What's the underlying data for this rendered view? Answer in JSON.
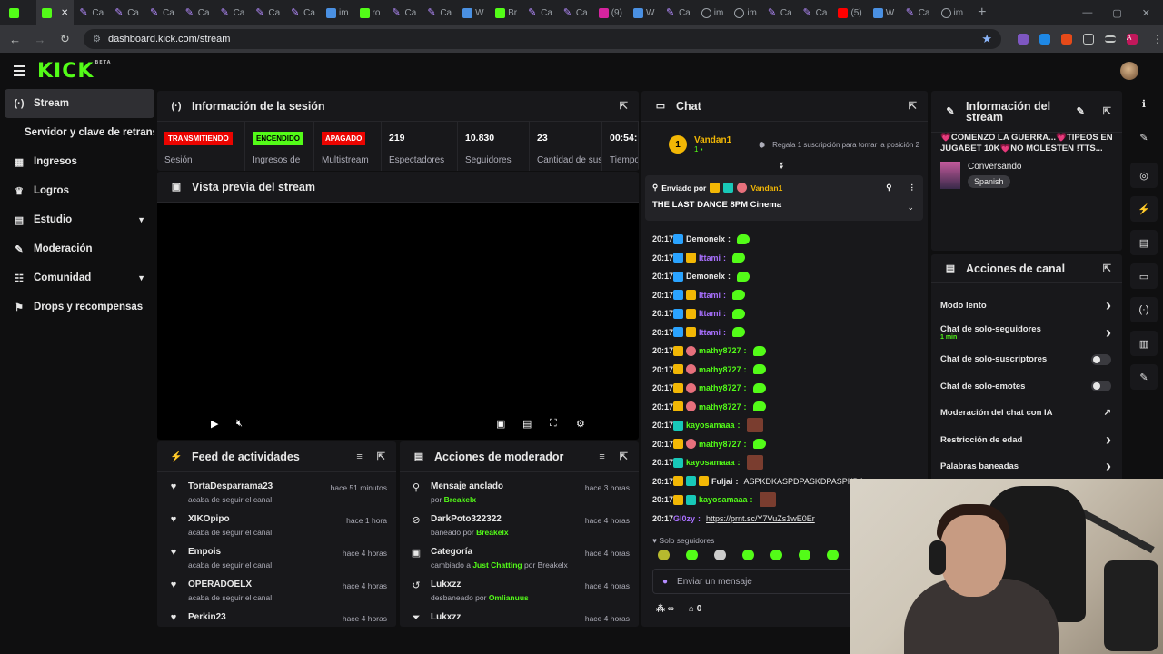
{
  "browser": {
    "tabs": [
      {
        "icon": "kick-logo-icon",
        "label": "",
        "active": false
      },
      {
        "icon": "kick-logo-icon",
        "label": "",
        "active": true
      },
      {
        "icon": "claude-icon",
        "label": "Ca"
      },
      {
        "icon": "claude-icon",
        "label": "Ca"
      },
      {
        "icon": "claude-icon",
        "label": "Ca"
      },
      {
        "icon": "claude-icon",
        "label": "Ca"
      },
      {
        "icon": "claude-icon",
        "label": "Ca"
      },
      {
        "icon": "claude-icon",
        "label": "Ca"
      },
      {
        "icon": "claude-icon",
        "label": "Ca"
      },
      {
        "icon": "blue-site-icon",
        "label": "im"
      },
      {
        "icon": "kick-logo-icon",
        "label": "ro"
      },
      {
        "icon": "claude-icon",
        "label": "Ca"
      },
      {
        "icon": "claude-icon",
        "label": "Ca"
      },
      {
        "icon": "blue-site-icon",
        "label": "W"
      },
      {
        "icon": "kick-logo-icon",
        "label": "Br"
      },
      {
        "icon": "claude-icon",
        "label": "Ca"
      },
      {
        "icon": "claude-icon",
        "label": "Ca"
      },
      {
        "icon": "instagram-icon",
        "label": "(9)"
      },
      {
        "icon": "blue-site-icon",
        "label": "W"
      },
      {
        "icon": "claude-icon",
        "label": "Ca"
      },
      {
        "icon": "globe-icon",
        "label": "im"
      },
      {
        "icon": "globe-icon",
        "label": "im"
      },
      {
        "icon": "claude-icon",
        "label": "Ca"
      },
      {
        "icon": "claude-icon",
        "label": "Ca"
      },
      {
        "icon": "youtube-icon",
        "label": "(5)"
      },
      {
        "icon": "blue-site-icon",
        "label": "W"
      },
      {
        "icon": "claude-icon",
        "label": "Ca"
      },
      {
        "icon": "globe-icon",
        "label": "im"
      }
    ],
    "url": "dashboard.kick.com/stream",
    "profile_initial": "A"
  },
  "site": {
    "logo": "KICK",
    "beta": "BETA"
  },
  "leftnav": [
    {
      "icon": "stream-icon",
      "glyph": "(·)",
      "label": "Stream",
      "selected": true,
      "sub": false,
      "chev": false
    },
    {
      "icon": "",
      "glyph": "",
      "label": "Servidor y clave de retransmisión",
      "selected": false,
      "sub": true,
      "chev": false
    },
    {
      "icon": "revenue-icon",
      "glyph": "▦",
      "label": "Ingresos",
      "selected": false,
      "sub": false,
      "chev": false
    },
    {
      "icon": "trophy-icon",
      "glyph": "♛",
      "label": "Logros",
      "selected": false,
      "sub": false,
      "chev": false
    },
    {
      "icon": "studio-icon",
      "glyph": "▤",
      "label": "Estudio",
      "selected": false,
      "sub": false,
      "chev": true
    },
    {
      "icon": "wrench-icon",
      "glyph": "✎",
      "label": "Moderación",
      "selected": false,
      "sub": false,
      "chev": false
    },
    {
      "icon": "community-icon",
      "glyph": "☷",
      "label": "Comunidad",
      "selected": false,
      "sub": false,
      "chev": true
    },
    {
      "icon": "gift-icon",
      "glyph": "⚑",
      "label": "Drops y recompensas",
      "selected": false,
      "sub": false,
      "chev": false
    }
  ],
  "session": {
    "title": "Información de la sesión",
    "metrics": [
      {
        "value": "TRANSMITIENDO",
        "type": "red",
        "label": "Sesión",
        "w": 97
      },
      {
        "value": "ENCENDIDO",
        "type": "green",
        "label": "Ingresos de",
        "w": 76
      },
      {
        "value": "APAGADO",
        "type": "red",
        "label": "Multistream",
        "w": 74
      },
      {
        "value": "219",
        "type": "num",
        "label": "Espectadores",
        "w": 84
      },
      {
        "value": "10.830",
        "type": "num",
        "label": "Seguidores",
        "w": 79
      },
      {
        "value": "23",
        "type": "num",
        "label": "Cantidad de suscripciones",
        "w": 80
      },
      {
        "value": "00:54:",
        "type": "num",
        "label": "Tiempo en vivo",
        "w": 40
      }
    ]
  },
  "preview": {
    "title": "Vista previa del stream"
  },
  "feed": {
    "title": "Feed de actividades",
    "items": [
      {
        "name": "TortaDesparrama23",
        "sub": "acaba de seguir el canal",
        "time": "hace 51 minutos"
      },
      {
        "name": "XIKOpipo",
        "sub": "acaba de seguir el canal",
        "time": "hace 1 hora"
      },
      {
        "name": "Empois",
        "sub": "acaba de seguir el canal",
        "time": "hace 4 horas"
      },
      {
        "name": "OPERADOELX",
        "sub": "acaba de seguir el canal",
        "time": "hace 4 horas"
      },
      {
        "name": "Perkin23",
        "sub": "",
        "time": "hace 4 horas"
      }
    ]
  },
  "modactions": {
    "title": "Acciones de moderador",
    "items": [
      {
        "icon": "pin-icon",
        "glyph": "⚲",
        "name": "Mensaje anclado",
        "pre": "por ",
        "hl": "Breakelx",
        "post": "",
        "time": "hace 3 horas"
      },
      {
        "icon": "ban-icon",
        "glyph": "⊘",
        "name": "DarkPoto322322",
        "pre": "baneado por ",
        "hl": "Breakelx",
        "post": "",
        "time": "hace 4 horas"
      },
      {
        "icon": "category-icon",
        "glyph": "▣",
        "name": "Categoría",
        "pre": "cambiado a ",
        "hl": "Just Chatting",
        "post": " por Breakelx",
        "time": "hace 4 horas"
      },
      {
        "icon": "unban-icon",
        "glyph": "↺",
        "name": "Lukxzz",
        "pre": "desbaneado por ",
        "hl": "Omlianuus",
        "post": "",
        "time": "hace 4 horas"
      },
      {
        "icon": "filter-icon",
        "glyph": "⏷",
        "name": "Lukxzz",
        "pre": "",
        "hl": "",
        "post": "",
        "time": "hace 4 horas"
      }
    ]
  },
  "chat": {
    "title": "Chat",
    "goal_user": "Vandan1",
    "goal_rank": "1",
    "goal_count": "1",
    "goal_text": "Regala 1 suscripción para tomar la posición 2",
    "pinned_by_label": "Enviado por",
    "pinned_user": "Vandan1",
    "pinned_msg": "THE LAST DANCE 8PM Cinema",
    "messages": [
      {
        "time": "20:17",
        "user": "Demonelx",
        "color": "#e7e7e7",
        "badges": [
          "blue"
        ],
        "text": "",
        "emote": "green"
      },
      {
        "time": "20:17",
        "user": "Ittami",
        "color": "#a970ff",
        "badges": [
          "blue",
          "gold"
        ],
        "text": "",
        "emote": "green"
      },
      {
        "time": "20:17",
        "user": "Demonelx",
        "color": "#e7e7e7",
        "badges": [
          "blue"
        ],
        "text": "",
        "emote": "green"
      },
      {
        "time": "20:17",
        "user": "Ittami",
        "color": "#a970ff",
        "badges": [
          "blue",
          "gold"
        ],
        "text": "",
        "emote": "green"
      },
      {
        "time": "20:17",
        "user": "Ittami",
        "color": "#a970ff",
        "badges": [
          "blue",
          "gold"
        ],
        "text": "",
        "emote": "green"
      },
      {
        "time": "20:17",
        "user": "Ittami",
        "color": "#a970ff",
        "badges": [
          "blue",
          "gold"
        ],
        "text": "",
        "emote": "green"
      },
      {
        "time": "20:17",
        "user": "mathy8727",
        "color": "#53fc18",
        "badges": [
          "gold",
          "pink"
        ],
        "text": "",
        "emote": "green"
      },
      {
        "time": "20:17",
        "user": "mathy8727",
        "color": "#53fc18",
        "badges": [
          "gold",
          "pink"
        ],
        "text": "",
        "emote": "green"
      },
      {
        "time": "20:17",
        "user": "mathy8727",
        "color": "#53fc18",
        "badges": [
          "gold",
          "pink"
        ],
        "text": "",
        "emote": "green"
      },
      {
        "time": "20:17",
        "user": "mathy8727",
        "color": "#53fc18",
        "badges": [
          "gold",
          "pink"
        ],
        "text": "",
        "emote": "green"
      },
      {
        "time": "20:17",
        "user": "kayosamaaa",
        "color": "#53fc18",
        "badges": [
          "teal"
        ],
        "text": "",
        "emote": "img"
      },
      {
        "time": "20:17",
        "user": "mathy8727",
        "color": "#53fc18",
        "badges": [
          "gold",
          "pink"
        ],
        "text": "",
        "emote": "green"
      },
      {
        "time": "20:17",
        "user": "kayosamaaa",
        "color": "#53fc18",
        "badges": [
          "teal"
        ],
        "text": "",
        "emote": "img"
      },
      {
        "time": "20:17",
        "user": "Fuljai",
        "color": "#e7e7e7",
        "badges": [
          "gold",
          "teal",
          "gold"
        ],
        "text": "ASPKDKASPDPASKDPASPKDA",
        "emote": ""
      },
      {
        "time": "20:17",
        "user": "kayosamaaa",
        "color": "#53fc18",
        "badges": [
          "gold",
          "teal"
        ],
        "text": "",
        "emote": "img"
      },
      {
        "time": "20:17",
        "user": "Gl0zy",
        "color": "#a970ff",
        "badges": [],
        "text": "https://prnt.sc/Y7VuZs1wE0Er",
        "emote": "",
        "link": true
      }
    ],
    "followers_only": "Solo seguidores",
    "input_placeholder": "Enviar un mensaje",
    "foot_count": "0"
  },
  "streaminfo": {
    "title": "Información del stream",
    "stream_title": "💗COMENZO LA GUERRA...💗TIPEOS EN JUGABET 10K💗NO MOLESTEN !TTS...",
    "category": "Conversando",
    "language": "Spanish"
  },
  "channelactions": {
    "title": "Acciones de canal",
    "rows": [
      {
        "label": "Modo lento",
        "sub": "",
        "ctl": "chevron"
      },
      {
        "label": "Chat de solo-seguidores",
        "sub": "1 min",
        "ctl": "chevron"
      },
      {
        "label": "Chat de solo-suscriptores",
        "sub": "",
        "ctl": "toggle"
      },
      {
        "label": "Chat de solo-emotes",
        "sub": "",
        "ctl": "toggle"
      },
      {
        "label": "Moderación del chat con IA",
        "sub": "",
        "ctl": "external"
      },
      {
        "label": "Restricción de edad",
        "sub": "",
        "ctl": "chevron"
      },
      {
        "label": "Palabras baneadas",
        "sub": "",
        "ctl": "chevron"
      }
    ]
  },
  "rail": [
    {
      "icon": "info-icon",
      "glyph": "ℹ",
      "box": false
    },
    {
      "icon": "edit-icon",
      "glyph": "✎",
      "box": false
    },
    {
      "icon": "target-icon",
      "glyph": "◎",
      "box": true
    },
    {
      "icon": "bolt-icon",
      "glyph": "⚡",
      "box": true
    },
    {
      "icon": "note-icon",
      "glyph": "▤",
      "box": true
    },
    {
      "icon": "chat-icon",
      "glyph": "▭",
      "box": true
    },
    {
      "icon": "broadcast-icon",
      "glyph": "(·)",
      "box": true
    },
    {
      "icon": "layout-icon",
      "glyph": "▥",
      "box": true
    },
    {
      "icon": "wrench-icon",
      "glyph": "✎",
      "box": true
    }
  ]
}
